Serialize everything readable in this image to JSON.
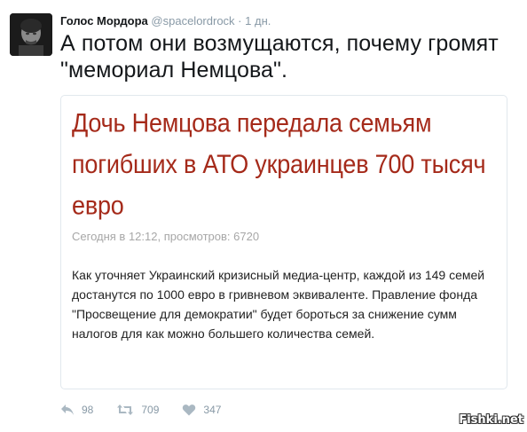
{
  "tweet": {
    "author_name": "Голос Мордора",
    "author_handle": "@spacelordrock",
    "time_separator": "·",
    "timestamp": "1 дн.",
    "text": "А потом они возмущаются, почему громят \"мемориал Немцова\"."
  },
  "card": {
    "headline": "Дочь Немцова передала семьям погибших в АТО украинцев 700 тысяч евро",
    "meta": "Сегодня в 12:12, просмотров: 6720",
    "body": "Как уточняет Украинский кризисный медиа-центр, каждой из 149 семей достанутся по 1000 евро в гривневом эквиваленте. Правление фонда \"Просвещение для демократии\" будет бороться за снижение сумм налогов для как можно большего количества семей.",
    "headline_color": "#a52a1a"
  },
  "actions": {
    "reply": {
      "icon": "reply-icon",
      "count": "98"
    },
    "retweet": {
      "icon": "retweet-icon",
      "count": "709"
    },
    "like": {
      "icon": "heart-icon",
      "count": "347"
    }
  },
  "watermark": "Fishki.net",
  "colors": {
    "muted": "#8899a6",
    "text": "#14171a",
    "border": "#e1e8ed"
  }
}
